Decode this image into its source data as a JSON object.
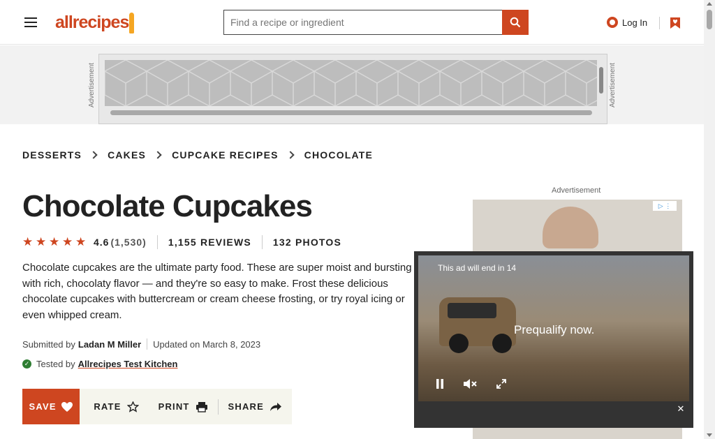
{
  "header": {
    "logo_text": "allrecipes",
    "search_placeholder": "Find a recipe or ingredient",
    "login_label": "Log In"
  },
  "ad_band": {
    "label": "Advertisement"
  },
  "breadcrumb": [
    {
      "label": "DESSERTS"
    },
    {
      "label": "CAKES"
    },
    {
      "label": "CUPCAKE RECIPES"
    },
    {
      "label": "CHOCOLATE"
    }
  ],
  "recipe": {
    "title": "Chocolate Cupcakes",
    "rating": "4.6",
    "rating_count": "(1,530)",
    "reviews_label": "1,155 REVIEWS",
    "photos_label": "132 PHOTOS",
    "description": "Chocolate cupcakes are the ultimate party food. These are super moist and bursting with rich, chocolaty flavor — and they're so easy to make. Frost these delicious chocolate cupcakes with buttercream or cream cheese frosting, or try royal icing or even whipped cream.",
    "submitted_prefix": "Submitted by",
    "author": "Ladan M Miller",
    "updated": "Updated on March 8, 2023",
    "tested_prefix": "Tested by",
    "tested_by": "Allrecipes Test Kitchen"
  },
  "actions": {
    "save": "SAVE",
    "rate": "RATE",
    "print": "PRINT",
    "share": "SHARE"
  },
  "right_column": {
    "ad_label": "Advertisement"
  },
  "video_ad": {
    "countdown": "This ad will end in 14",
    "promo_text": "Prequalify now."
  },
  "colors": {
    "brand": "#ce4620",
    "action_bar": "#f5f5ed"
  }
}
